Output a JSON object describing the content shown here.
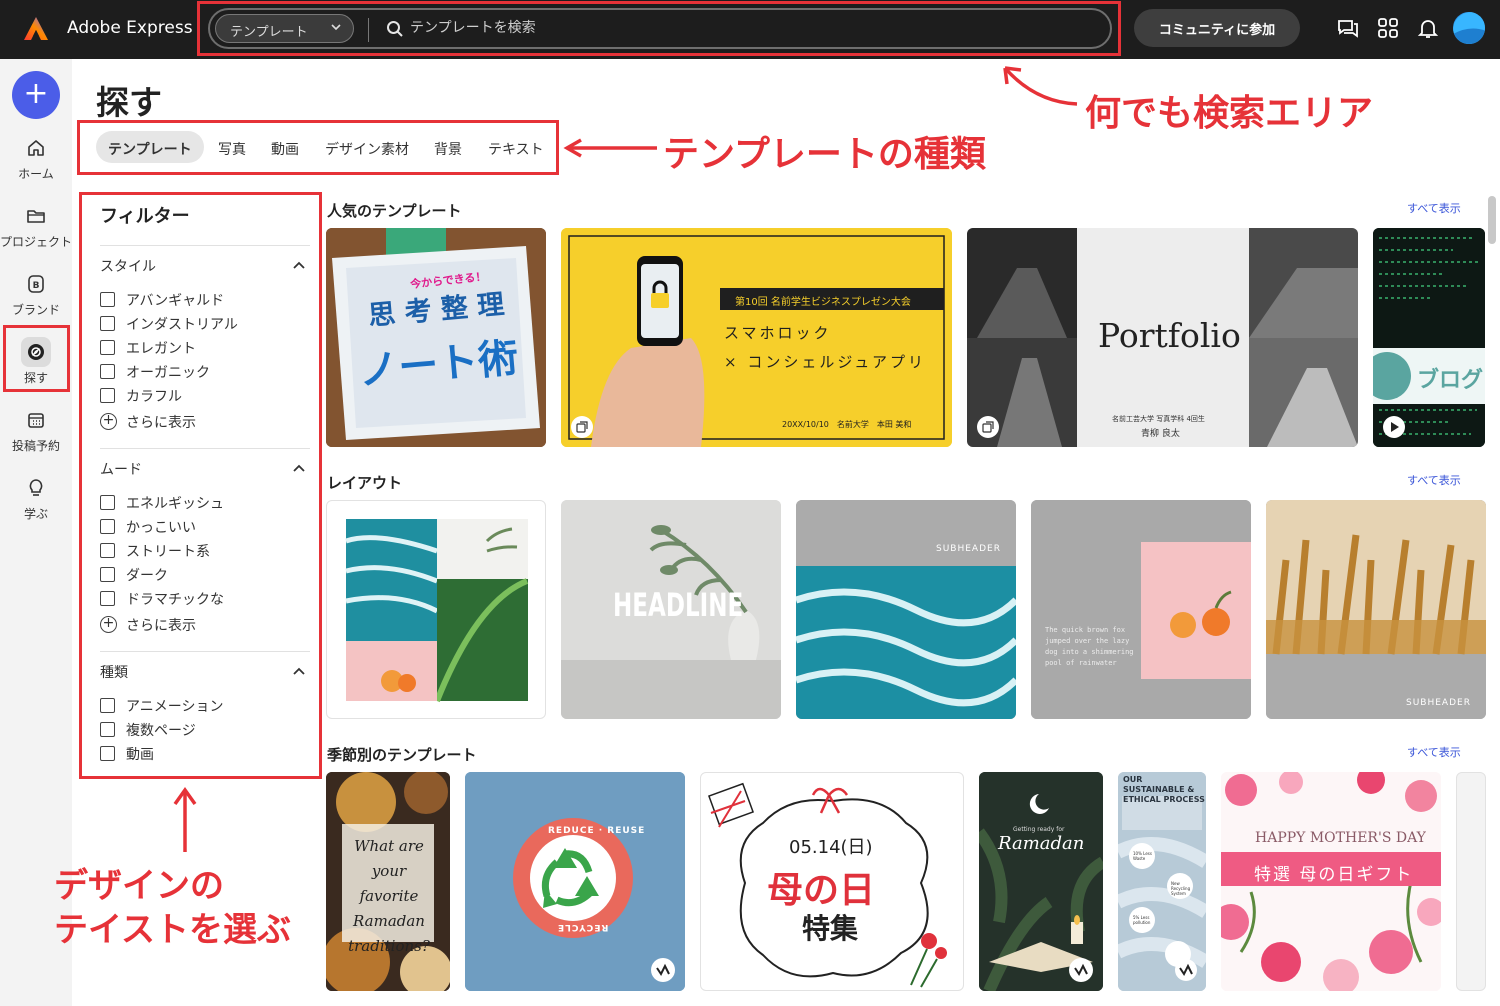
{
  "app": {
    "name": "Adobe Express"
  },
  "search": {
    "scope": "テンプレート",
    "placeholder": "テンプレートを検索"
  },
  "header": {
    "community_button": "コミュニティに参加"
  },
  "rail": {
    "create_label": "+",
    "items": [
      {
        "label": "ホーム",
        "icon": "home-icon"
      },
      {
        "label": "プロジェクト",
        "icon": "folder-icon"
      },
      {
        "label": "ブランド",
        "icon": "brand-icon"
      },
      {
        "label": "探す",
        "icon": "discover-icon"
      },
      {
        "label": "投稿予約",
        "icon": "calendar-icon"
      },
      {
        "label": "学ぶ",
        "icon": "lightbulb-icon"
      }
    ]
  },
  "page": {
    "title": "探す"
  },
  "tabs": [
    {
      "label": "テンプレート"
    },
    {
      "label": "写真"
    },
    {
      "label": "動画"
    },
    {
      "label": "デザイン素材"
    },
    {
      "label": "背景"
    },
    {
      "label": "テキスト"
    }
  ],
  "filters": {
    "title": "フィルター",
    "more_label": "さらに表示",
    "groups": [
      {
        "label": "スタイル",
        "options": [
          "アバンギャルド",
          "インダストリアル",
          "エレガント",
          "オーガニック",
          "カラフル"
        ]
      },
      {
        "label": "ムード",
        "options": [
          "エネルギッシュ",
          "かっこいい",
          "ストリート系",
          "ダーク",
          "ドラマチックな"
        ]
      },
      {
        "label": "種類",
        "options": [
          "アニメーション",
          "複数ページ",
          "動画"
        ]
      }
    ]
  },
  "sections": {
    "see_all": "すべて表示",
    "popular": "人気のテンプレート",
    "layout": "レイアウト",
    "seasonal": "季節別のテンプレート"
  },
  "cards": {
    "note": {
      "line1": "今からできる！",
      "line2": "思 考 整 理",
      "line3": "ノート術"
    },
    "lock": {
      "banner": "第10回 名前学生ビジネスプレゼン大会",
      "line1": "スマホロック",
      "line2": "× コンシェルジュアプリ",
      "footer": "20XX/10/10　名前大学　本田 美和"
    },
    "portfolio": {
      "title": "Portfolio",
      "sub": "名前工芸大学 写真学科 4回生",
      "name": "青柳 良太"
    },
    "blog": {
      "label": "ブログ"
    },
    "headline": {
      "text": "HEADLINE"
    },
    "subheader": "SUBHEADER",
    "quick_fox": "The quick brown fox jumped over the lazy dog into a shimmering pool of rainwater",
    "ramadan_q": "What are your favorite Ramadan traditions?",
    "reduce": {
      "top": "REDUCE · REUSE",
      "bottom": "RECYCLE"
    },
    "mothers": {
      "date": "05.14(日)",
      "title": "母の日",
      "sub": "特集"
    },
    "ramadan": {
      "small": "Getting ready for",
      "title": "Ramadan"
    },
    "sustain": {
      "title": "OUR SUSTAINABLE & ETHICAL PROCESS",
      "b1": "10% Less Waste",
      "b2": "New Recycling System",
      "b3": "5% Less pollution"
    },
    "happy": {
      "title": "HAPPY MOTHER'S DAY",
      "banner": "特選 母の日ギフト"
    }
  },
  "annotations": {
    "search": "何でも検索エリア",
    "tabs": "テンプレートの種類",
    "filter_line1": "デザインの",
    "filter_line2": "テイストを選ぶ"
  },
  "colors": {
    "accent": "#4b5de8",
    "annotation": "#e63238",
    "topbar": "#1d1d1d",
    "link": "#3a55d8"
  }
}
